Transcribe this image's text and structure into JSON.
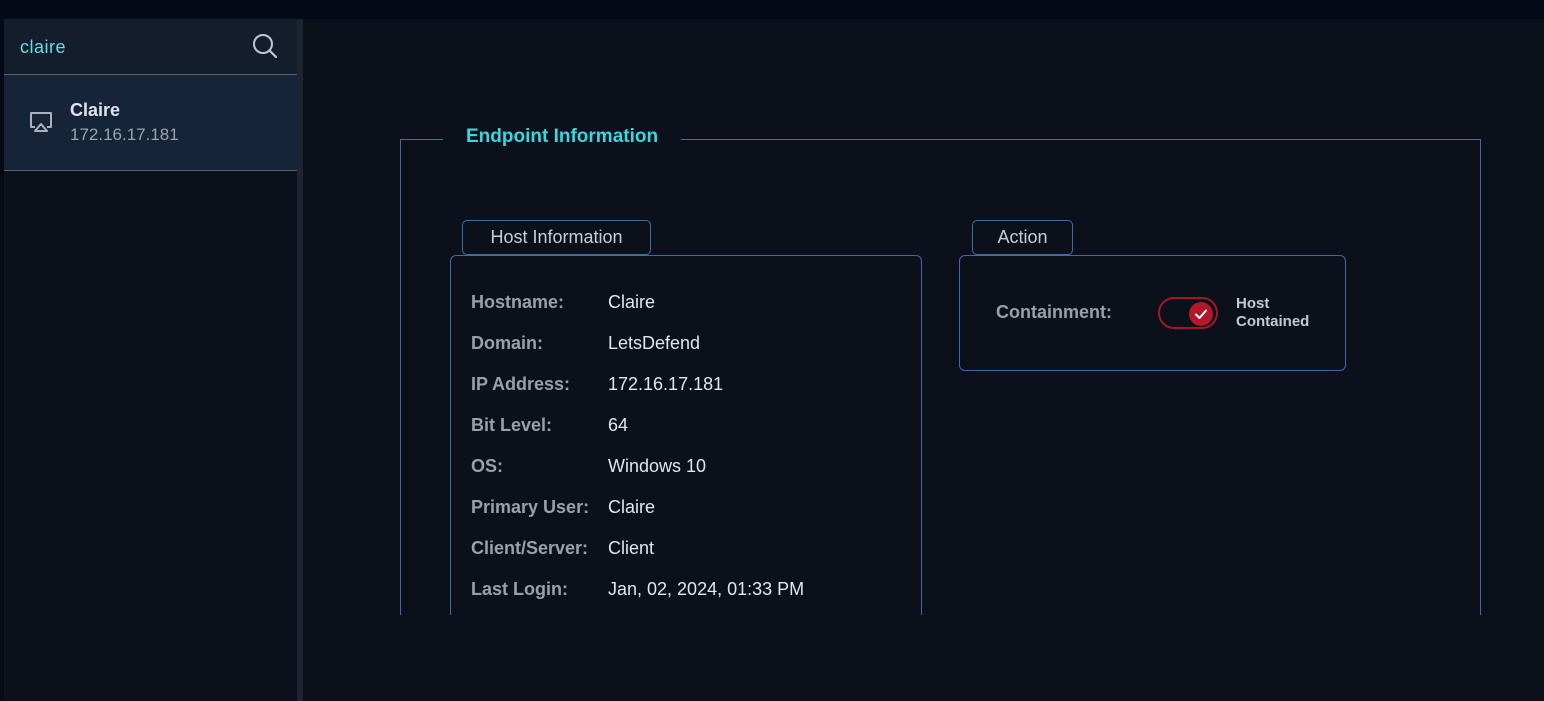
{
  "search": {
    "value": "claire"
  },
  "hosts": [
    {
      "name": "Claire",
      "ip": "172.16.17.181"
    }
  ],
  "endpoint": {
    "title": "Endpoint Information",
    "host_section": {
      "label": "Host Information",
      "rows": [
        {
          "label": "Hostname:",
          "value": "Claire"
        },
        {
          "label": "Domain:",
          "value": "LetsDefend"
        },
        {
          "label": "IP Address:",
          "value": "172.16.17.181"
        },
        {
          "label": "Bit Level:",
          "value": "64"
        },
        {
          "label": "OS:",
          "value": "Windows 10"
        },
        {
          "label": "Primary User:",
          "value": "Claire"
        },
        {
          "label": "Client/Server:",
          "value": "Client"
        },
        {
          "label": "Last Login:",
          "value": "Jan, 02, 2024, 01:33 PM"
        }
      ]
    },
    "action_section": {
      "label": "Action",
      "containment_label": "Containment:",
      "toggle_on": true,
      "status_line1": "Host",
      "status_line2": "Contained"
    }
  },
  "colors": {
    "accent": "#37d8de",
    "border": "#3f6aa8",
    "toggle": "#b3182a"
  }
}
